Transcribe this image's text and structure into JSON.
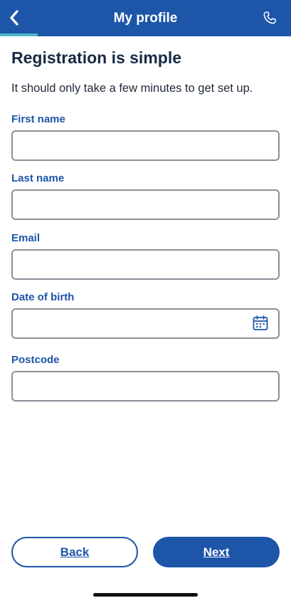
{
  "header": {
    "title": "My profile",
    "back_icon": "chevron-left-icon",
    "phone_icon": "phone-icon",
    "progress": 0.13,
    "colors": {
      "bar": "#1d55a8",
      "progress": "#4fb4c6"
    }
  },
  "main": {
    "heading": "Registration is simple",
    "subheading": "It should only take a few minutes to get set up.",
    "fields": {
      "first_name": {
        "label": "First name",
        "value": ""
      },
      "last_name": {
        "label": "Last name",
        "value": ""
      },
      "email": {
        "label": "Email",
        "value": ""
      },
      "dob": {
        "label": "Date of birth",
        "value": "",
        "icon": "calendar-icon"
      },
      "postcode": {
        "label": "Postcode",
        "value": ""
      }
    }
  },
  "footer": {
    "back_label": "Back",
    "next_label": "Next",
    "colors": {
      "primary": "#1d55a8"
    }
  }
}
